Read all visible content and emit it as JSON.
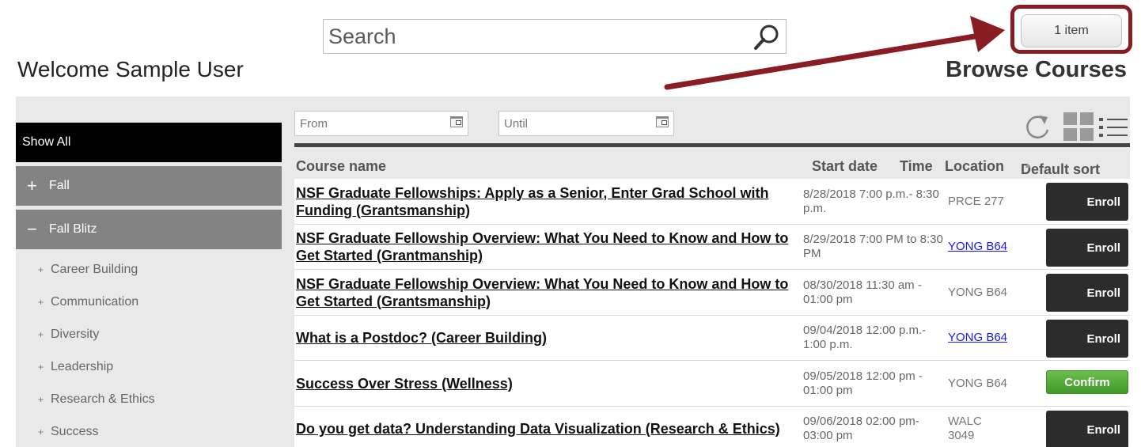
{
  "header": {
    "welcome": "Welcome Sample User",
    "search_placeholder": "Search",
    "cart_label": "1 item",
    "browse_title": "Browse Courses"
  },
  "sidebar": {
    "show_all": "Show All",
    "groups": [
      {
        "symbol": "+",
        "label": "Fall"
      },
      {
        "symbol": "−",
        "label": "Fall Blitz"
      }
    ],
    "items": [
      {
        "bullet": "+",
        "label": "Career Building"
      },
      {
        "bullet": "+",
        "label": "Communication"
      },
      {
        "bullet": "+",
        "label": "Diversity"
      },
      {
        "bullet": "+",
        "label": "Leadership"
      },
      {
        "bullet": "+",
        "label": "Research & Ethics"
      },
      {
        "bullet": "+",
        "label": "Success"
      }
    ]
  },
  "filters": {
    "from_placeholder": "From",
    "until_placeholder": "Until"
  },
  "table": {
    "headers": {
      "course": "Course name",
      "start": "Start date",
      "time": "Time",
      "location": "Location",
      "sort": "Default sort"
    },
    "rows": [
      {
        "name": "NSF Graduate Fellowships: Apply as a Senior, Enter Grad School with Funding (Grantsmanship)",
        "datetime": "8/28/2018 7:00 p.m.- 8:30 p.m.",
        "location": "PRCE 277",
        "action": "Enroll"
      },
      {
        "name": "NSF Graduate Fellowship Overview: What You Need to Know and How to Get Started (Grantmanship)",
        "datetime": "8/29/2018 7:00 PM to 8:30 PM",
        "location": "YONG B64",
        "action": "Enroll"
      },
      {
        "name": "NSF Graduate Fellowship Overview: What You Need to Know and How to Get Started (Grantsmanship)",
        "datetime": "08/30/2018 11:30 am - 01:00 pm",
        "location": "YONG B64",
        "action": "Enroll"
      },
      {
        "name": "What is a Postdoc? (Career Building)",
        "datetime": "09/04/2018 12:00 p.m.- 1:00 p.m.",
        "location": "YONG B64",
        "action": "Enroll"
      },
      {
        "name": "Success Over Stress (Wellness)",
        "datetime": "09/05/2018 12:00 pm - 01:00 pm",
        "location": "YONG B64",
        "action": "Confirm"
      },
      {
        "name": "Do you get data? Understanding Data Visualization (Research & Ethics)",
        "datetime": "09/06/2018 02:00 pm- 03:00 pm",
        "location": "WALC 3049",
        "action": "Enroll"
      }
    ]
  },
  "colors": {
    "annotation_arrow": "#8a1c24",
    "enroll_button": "#2c2c2c",
    "confirm_button": "#4aa532",
    "link_location": "#1a1aee"
  }
}
